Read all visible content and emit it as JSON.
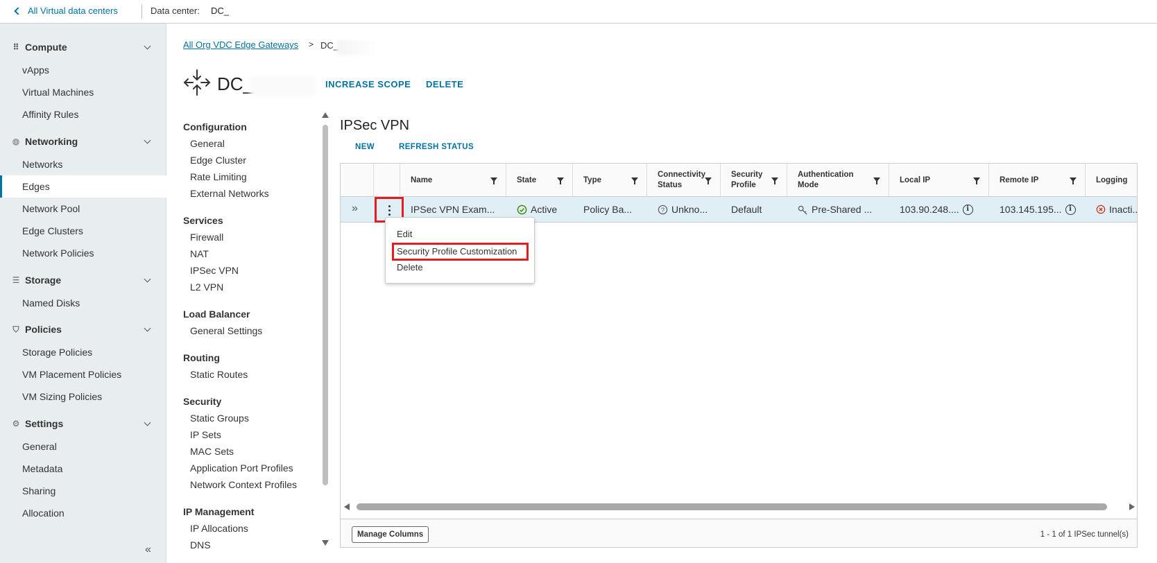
{
  "topbar": {
    "back_label": "All Virtual data centers",
    "dc_label": "Data center:",
    "dc_name": "DC_"
  },
  "sidebar": {
    "sections": [
      {
        "title": "Compute",
        "items": [
          "vApps",
          "Virtual Machines",
          "Affinity Rules"
        ]
      },
      {
        "title": "Networking",
        "items": [
          "Networks",
          "Edges",
          "Network Pool",
          "Edge Clusters",
          "Network Policies"
        ]
      },
      {
        "title": "Storage",
        "items": [
          "Named Disks"
        ]
      },
      {
        "title": "Policies",
        "items": [
          "Storage Policies",
          "VM Placement Policies",
          "VM Sizing Policies"
        ]
      },
      {
        "title": "Settings",
        "items": [
          "General",
          "Metadata",
          "Sharing",
          "Allocation"
        ]
      }
    ],
    "active_item": "Edges",
    "collapse_icon": "double-chevron-left-icon"
  },
  "breadcrumb": {
    "link": "All Org VDC Edge Gateways",
    "separator": ">",
    "current": "DC_"
  },
  "page": {
    "title": "DC_",
    "actions": [
      "INCREASE SCOPE",
      "DELETE"
    ]
  },
  "secondary_nav": {
    "groups": [
      {
        "title": "Configuration",
        "items": [
          "General",
          "Edge Cluster",
          "Rate Limiting",
          "External Networks"
        ]
      },
      {
        "title": "Services",
        "items": [
          "Firewall",
          "NAT",
          "IPSec VPN",
          "L2 VPN"
        ]
      },
      {
        "title": "Load Balancer",
        "items": [
          "General Settings"
        ]
      },
      {
        "title": "Routing",
        "items": [
          "Static Routes"
        ]
      },
      {
        "title": "Security",
        "items": [
          "Static Groups",
          "IP Sets",
          "MAC Sets",
          "Application Port Profiles",
          "Network Context Profiles"
        ]
      },
      {
        "title": "IP Management",
        "items": [
          "IP Allocations",
          "DNS"
        ]
      }
    ],
    "active_item": "IPSec VPN"
  },
  "content": {
    "title": "IPSec VPN",
    "buttons": [
      "NEW",
      "REFRESH STATUS"
    ],
    "columns": [
      {
        "l1": "Name",
        "l2": ""
      },
      {
        "l1": "State",
        "l2": ""
      },
      {
        "l1": "Type",
        "l2": ""
      },
      {
        "l1": "Connectivity",
        "l2": "Status"
      },
      {
        "l1": "Security",
        "l2": "Profile"
      },
      {
        "l1": "Authentication",
        "l2": "Mode"
      },
      {
        "l1": "Local IP",
        "l2": ""
      },
      {
        "l1": "Remote IP",
        "l2": ""
      },
      {
        "l1": "Logging",
        "l2": ""
      }
    ],
    "row": {
      "name": "IPSec VPN Exam...",
      "state": "Active",
      "type": "Policy Ba...",
      "connectivity": "Unkno...",
      "security_profile": "Default",
      "auth_mode": "Pre-Shared ...",
      "local_ip": "103.90.248....",
      "remote_ip": "103.145.195...",
      "logging": "Inacti..."
    },
    "context_menu": [
      "Edit",
      "Security Profile Customization",
      "Delete"
    ],
    "manage_columns": "Manage Columns",
    "pager": "1 - 1 of 1 IPSec tunnel(s)"
  },
  "colors": {
    "accent": "#0072a3",
    "highlight": "#e0201f",
    "row_selected": "#e0eef5",
    "active_green": "#3c8500",
    "inactive_red": "#c92100"
  }
}
